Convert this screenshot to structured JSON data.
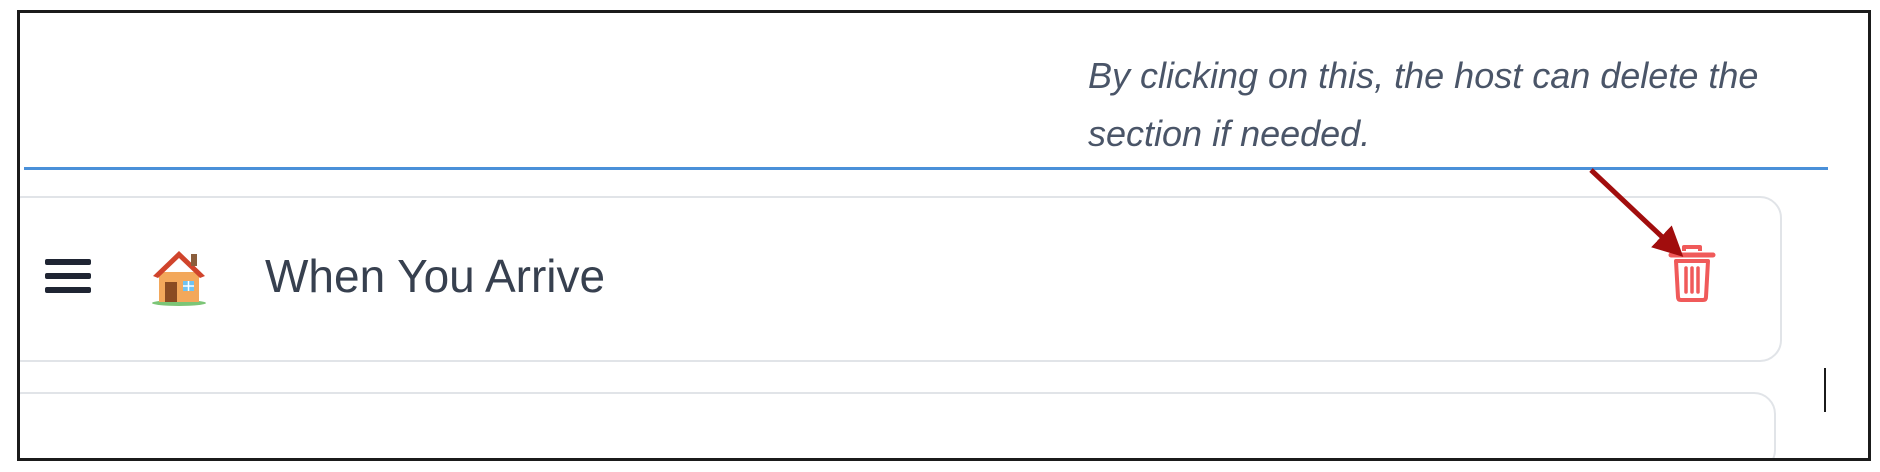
{
  "annotation": {
    "line1": "By clicking on this, the host can delete the",
    "line2": "section if needed."
  },
  "section": {
    "title": "When You Arrive",
    "emoji_icon": "house-icon",
    "handle_icon": "hamburger-icon",
    "delete_icon": "trash-icon"
  },
  "colors": {
    "accent_line": "#4a90d9",
    "delete_red": "#f05a5a",
    "arrow_red": "#a10d0d",
    "annotation_text": "#4a5568"
  }
}
